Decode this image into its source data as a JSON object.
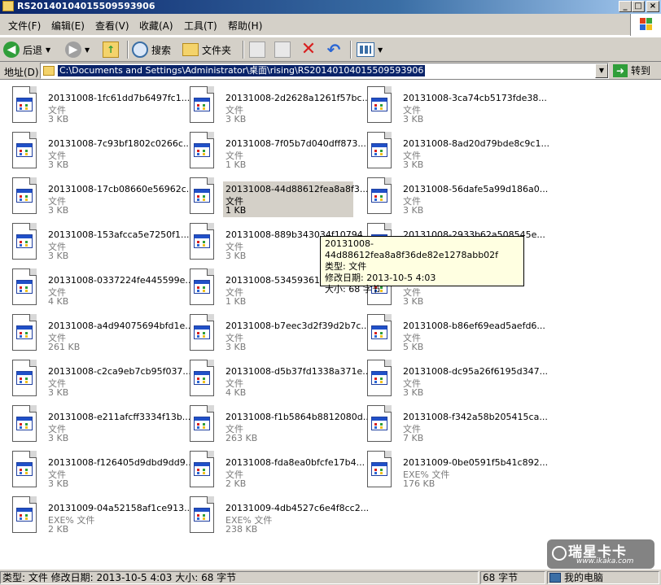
{
  "window": {
    "title": "RS20140104015509593906"
  },
  "menu": [
    "文件(F)",
    "编辑(E)",
    "查看(V)",
    "收藏(A)",
    "工具(T)",
    "帮助(H)"
  ],
  "toolbar": {
    "back_label": "后退",
    "search_label": "搜索",
    "folders_label": "文件夹"
  },
  "address": {
    "label": "地址(D)",
    "path": "C:\\Documents and Settings\\Administrator\\桌面\\rising\\RS20140104015509593906",
    "go_label": "转到"
  },
  "files": [
    {
      "name": "20131008-1fc61dd7b6497fc1...",
      "type": "文件",
      "size": "3 KB"
    },
    {
      "name": "20131008-2d2628a1261f57bc...",
      "type": "文件",
      "size": "3 KB"
    },
    {
      "name": "20131008-3ca74cb5173fde38...",
      "type": "文件",
      "size": "3 KB"
    },
    {
      "name": "20131008-7c93bf1802c0266c...",
      "type": "文件",
      "size": "3 KB"
    },
    {
      "name": "20131008-7f05b7d040dff873...",
      "type": "文件",
      "size": "1 KB"
    },
    {
      "name": "20131008-8ad20d79bde8c9c1...",
      "type": "文件",
      "size": "3 KB"
    },
    {
      "name": "20131008-17cb08660e56962c...",
      "type": "文件",
      "size": "3 KB"
    },
    {
      "name": "20131008-44d88612fea8a8f3...",
      "type": "文件",
      "size": "1 KB"
    },
    {
      "name": "20131008-56dafe5a99d186a0...",
      "type": "文件",
      "size": "3 KB"
    },
    {
      "name": "20131008-153afcca5e7250f1...",
      "type": "文件",
      "size": "3 KB"
    },
    {
      "name": "20131008-889b343034f10794...",
      "type": "文件",
      "size": "3 KB"
    },
    {
      "name": "20131008-2933b62a508545e...",
      "type": "文件",
      "size": "3 KB"
    },
    {
      "name": "20131008-0337224fe445599e...",
      "type": "文件",
      "size": "4 KB"
    },
    {
      "name": "20131008-53459361e07...",
      "type": "文件",
      "size": "1 KB"
    },
    {
      "name": "20131008-...",
      "type": "文件",
      "size": "3 KB"
    },
    {
      "name": "20131008-a4d94075694bfd1e...",
      "type": "文件",
      "size": "261 KB"
    },
    {
      "name": "20131008-b7eec3d2f39d2b7c...",
      "type": "文件",
      "size": "3 KB"
    },
    {
      "name": "20131008-b86ef69ead5aefd6...",
      "type": "文件",
      "size": "5 KB"
    },
    {
      "name": "20131008-c2ca9eb7cb95f037...",
      "type": "文件",
      "size": "3 KB"
    },
    {
      "name": "20131008-d5b37fd1338a371e...",
      "type": "文件",
      "size": "4 KB"
    },
    {
      "name": "20131008-dc95a26f6195d347...",
      "type": "文件",
      "size": "3 KB"
    },
    {
      "name": "20131008-e211afcff3334f13b...",
      "type": "文件",
      "size": "3 KB"
    },
    {
      "name": "20131008-f1b5864b8812080d...",
      "type": "文件",
      "size": "263 KB"
    },
    {
      "name": "20131008-f342a58b205415ca...",
      "type": "文件",
      "size": "7 KB"
    },
    {
      "name": "20131008-f126405d9dbd9dd9...",
      "type": "文件",
      "size": "3 KB"
    },
    {
      "name": "20131008-fda8ea0bfcfe17b4...",
      "type": "文件",
      "size": "2 KB"
    },
    {
      "name": "20131009-0be0591f5b41c892...",
      "type": "EXE% 文件",
      "size": "176 KB"
    },
    {
      "name": "20131009-04a52158af1ce913...",
      "type": "EXE% 文件",
      "size": "2 KB"
    },
    {
      "name": "20131009-4db4527c6e4f8cc2...",
      "type": "EXE% 文件",
      "size": "238 KB"
    }
  ],
  "selected_index": 7,
  "tooltip": {
    "line1": "20131008-44d88612fea8a8f36de82e1278abb02f",
    "line2": "类型: 文件",
    "line3": "修改日期: 2013-10-5 4:03",
    "line4": "大小: 68 字节"
  },
  "status": {
    "details": "类型: 文件 修改日期: 2013-10-5 4:03 大小: 68 字节",
    "size": "68 字节",
    "location": "我的电脑"
  },
  "watermark": {
    "brand": "瑞星卡卡",
    "url": "www.ikaka.com"
  }
}
